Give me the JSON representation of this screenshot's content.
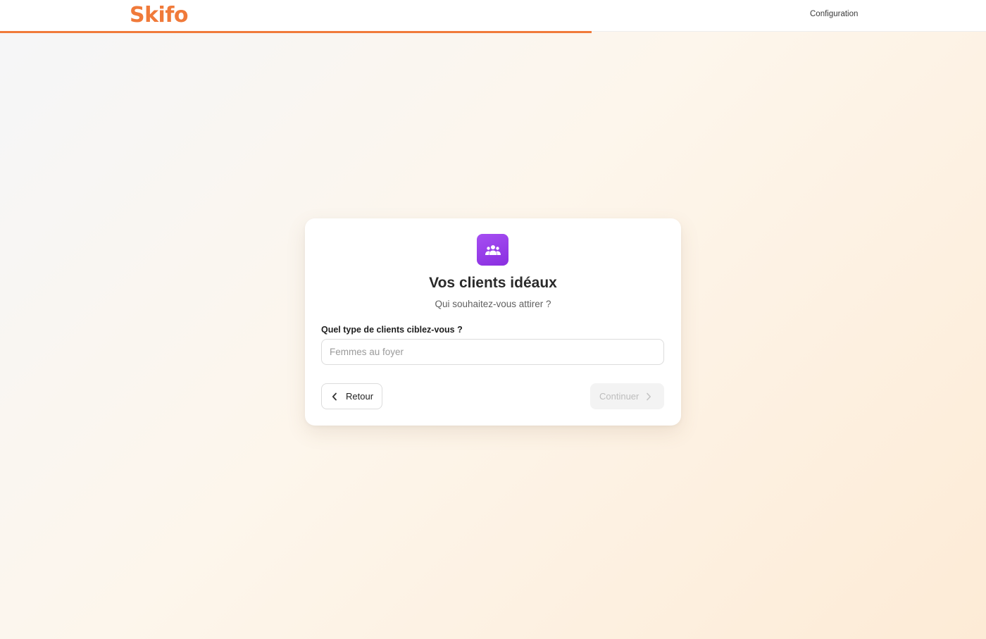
{
  "header": {
    "logo": "Skifo",
    "nav_config": "Configuration",
    "progress": 0.6
  },
  "card": {
    "icon": "users-group-icon",
    "title": "Vos clients idéaux",
    "subtitle": "Qui souhaitez-vous attirer ?",
    "field_label": "Quel type de clients ciblez-vous ?",
    "field_value": "",
    "field_placeholder": "Femmes au foyer",
    "back_label": "Retour",
    "continue_label": "Continuer",
    "continue_disabled": true
  },
  "colors": {
    "brand": "#f07a3a",
    "icon_bg": "#9b40ea"
  }
}
